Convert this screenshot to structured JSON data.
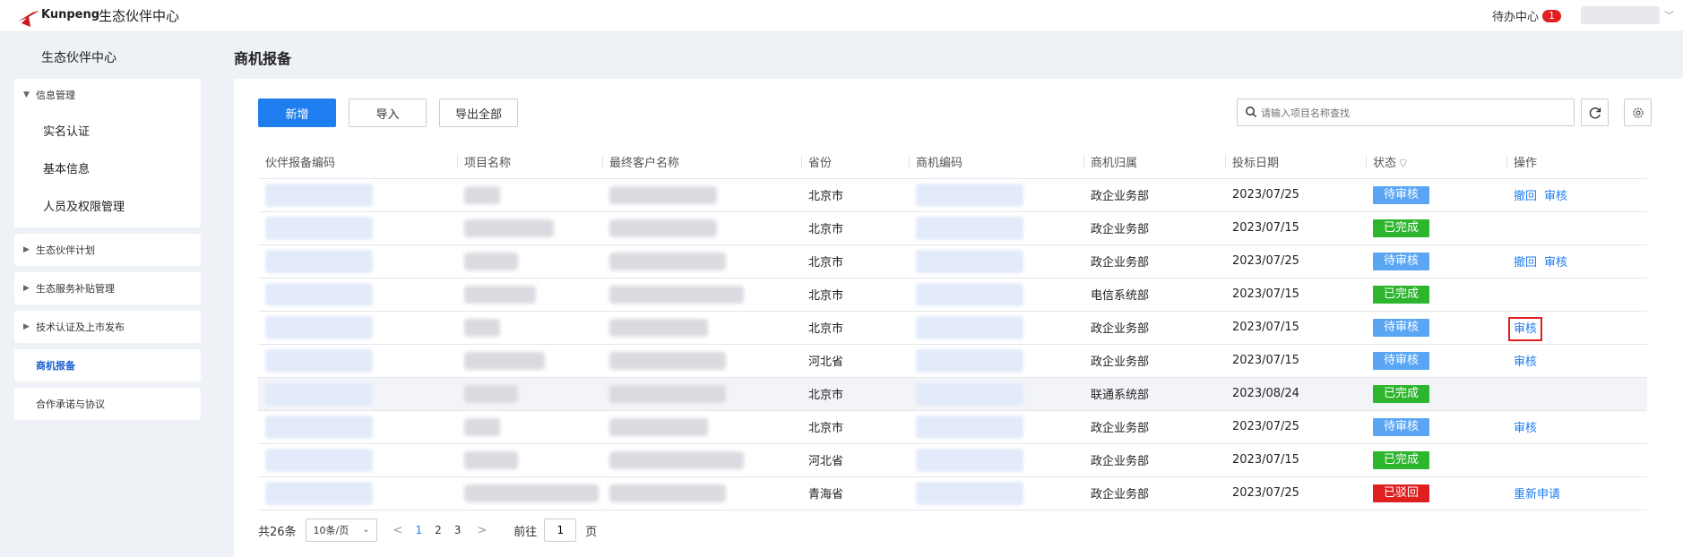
{
  "header": {
    "brand": "Kunpeng",
    "app_title": "生态伙伴中心",
    "todo_label": "待办中心",
    "todo_count": "1"
  },
  "sidebar": {
    "title": "生态伙伴中心",
    "groups": [
      {
        "label": "信息管理",
        "expanded": true,
        "items": [
          "实名认证",
          "基本信息",
          "人员及权限管理"
        ]
      },
      {
        "label": "生态伙伴计划",
        "expanded": false
      },
      {
        "label": "生态服务补贴管理",
        "expanded": false
      },
      {
        "label": "技术认证及上市发布",
        "expanded": false
      },
      {
        "label": "商机报备",
        "active": true
      },
      {
        "label": "合作承诺与协议"
      }
    ]
  },
  "main": {
    "page_title": "商机报备",
    "toolbar": {
      "new_label": "新增",
      "import_label": "导入",
      "export_label": "导出全部",
      "search_placeholder": "请输入项目名称查找"
    },
    "table": {
      "columns": [
        "伙伴报备编码",
        "项目名称",
        "最终客户名称",
        "省份",
        "商机编码",
        "商机归属",
        "投标日期",
        "状态",
        "操作"
      ],
      "rows": [
        {
          "province": "北京市",
          "belong": "政企业务部",
          "date": "2023/07/25",
          "status": "待审核",
          "actions": [
            "撤回",
            "审核"
          ]
        },
        {
          "province": "北京市",
          "belong": "政企业务部",
          "date": "2023/07/15",
          "status": "已完成",
          "actions": []
        },
        {
          "province": "北京市",
          "belong": "政企业务部",
          "date": "2023/07/25",
          "status": "待审核",
          "actions": [
            "撤回",
            "审核"
          ]
        },
        {
          "province": "北京市",
          "belong": "电信系统部",
          "date": "2023/07/15",
          "status": "已完成",
          "actions": []
        },
        {
          "province": "北京市",
          "belong": "政企业务部",
          "date": "2023/07/15",
          "status": "待审核",
          "actions": [
            "审核"
          ]
        },
        {
          "province": "河北省",
          "belong": "政企业务部",
          "date": "2023/07/15",
          "status": "待审核",
          "actions": [
            "审核"
          ]
        },
        {
          "province": "北京市",
          "belong": "联通系统部",
          "date": "2023/08/24",
          "status": "已完成",
          "actions": []
        },
        {
          "province": "北京市",
          "belong": "政企业务部",
          "date": "2023/07/25",
          "status": "待审核",
          "actions": [
            "审核"
          ]
        },
        {
          "province": "河北省",
          "belong": "政企业务部",
          "date": "2023/07/15",
          "status": "已完成",
          "actions": []
        },
        {
          "province": "青海省",
          "belong": "政企业务部",
          "date": "2023/07/25",
          "status": "已驳回",
          "actions": [
            "重新申请"
          ]
        }
      ]
    },
    "pager": {
      "total": "共26条",
      "page_size": "10条/页",
      "pages": [
        "1",
        "2",
        "3"
      ],
      "current": "1",
      "goto_label": "前往",
      "goto_value": "1",
      "goto_suffix": "页"
    }
  },
  "colors": {
    "primary": "#1e7ef0",
    "status_pending": "#5aa6f5",
    "status_done": "#2db52d",
    "status_rejected": "#e02020",
    "highlight_box": "#e02020"
  }
}
